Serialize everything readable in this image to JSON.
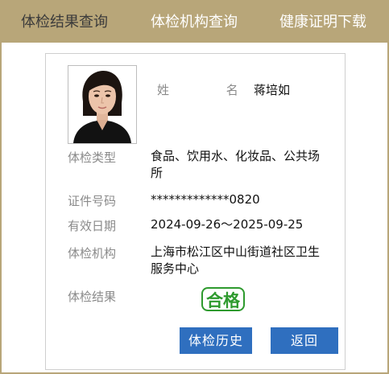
{
  "tabs": [
    {
      "label": "体检结果查询",
      "active": true
    },
    {
      "label": "体检机构查询",
      "active": false
    },
    {
      "label": "健康证明下载",
      "active": false
    }
  ],
  "profile": {
    "name_label": "姓 名",
    "name": "蒋培如",
    "fields": [
      {
        "label": "体检类型",
        "value": "食品、饮用水、化妆品、公共场所"
      },
      {
        "label": "证件号码",
        "value": "*************0820"
      },
      {
        "label": "有效日期",
        "value": "2024-09-26～2025-09-25"
      },
      {
        "label": "体检机构",
        "value": "上海市松江区中山街道社区卫生服务中心"
      },
      {
        "label": "体检结果",
        "value": ""
      }
    ],
    "result": "合格"
  },
  "buttons": {
    "history": "体检历史",
    "back": "返回"
  },
  "colors": {
    "tab_bar": "#b8a679",
    "button": "#2f6fbf",
    "result": "#2e9a2e"
  }
}
